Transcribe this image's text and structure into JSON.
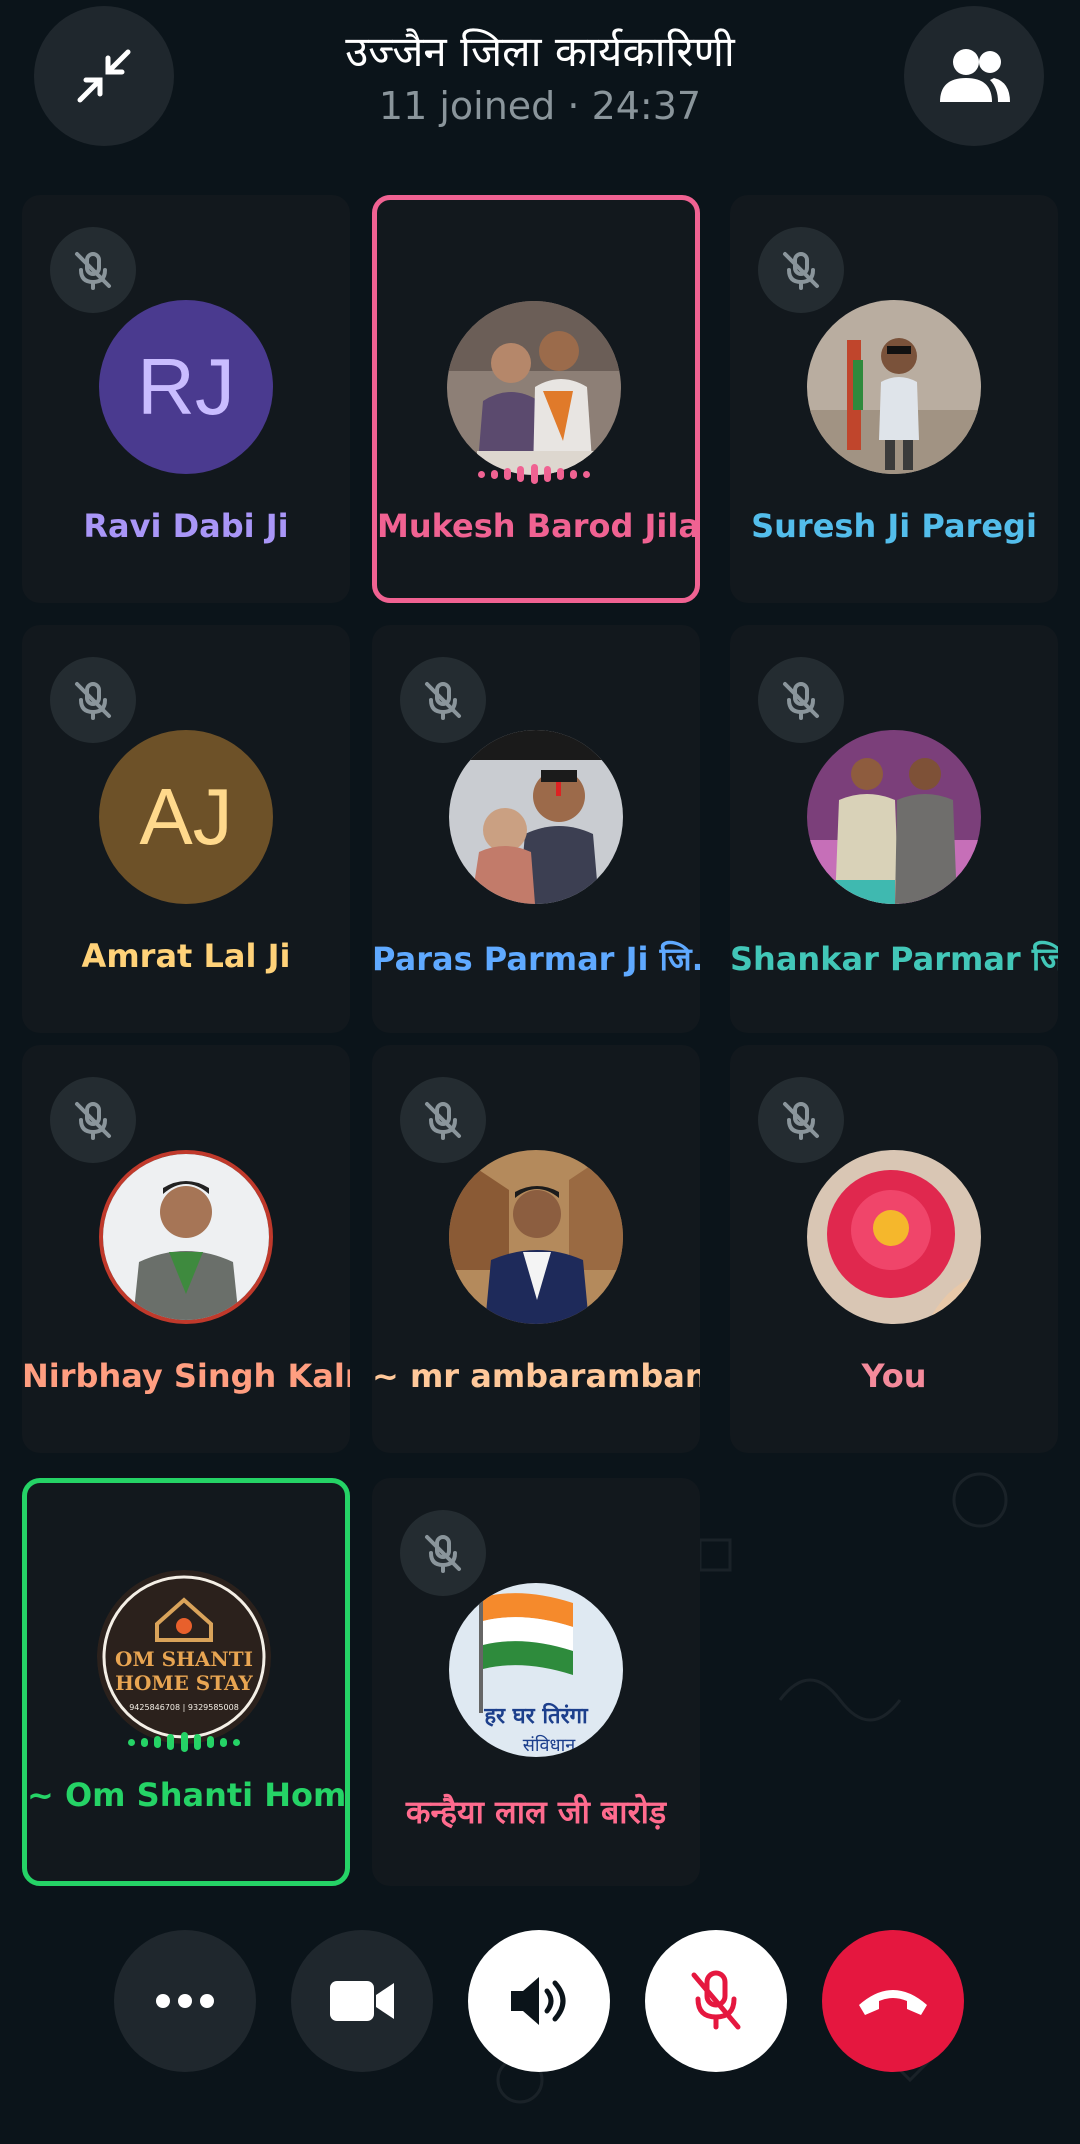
{
  "call": {
    "title": "उज्जैन जिला कार्यकारिणी",
    "joined": "11 joined",
    "separator": "·",
    "duration": "24:37"
  },
  "colors": {
    "background": "#0b141a",
    "tile": "#12181d",
    "speaking_pink": "#f06292",
    "speaking_green": "#25d366",
    "end_call": "#e5173f"
  },
  "participants": [
    {
      "name": "Ravi Dabi Ji",
      "initials": "RJ",
      "muted": true,
      "speaking": false,
      "name_color": "#a996f7"
    },
    {
      "name": "Mukesh Barod Jila ...",
      "muted": false,
      "speaking": true,
      "name_color": "#f06292"
    },
    {
      "name": "Suresh Ji Paregi",
      "muted": true,
      "speaking": false,
      "name_color": "#53bdeb"
    },
    {
      "name": "Amrat Lal Ji",
      "initials": "AJ",
      "muted": true,
      "speaking": false,
      "name_color": "#ffd279"
    },
    {
      "name": "Paras Parmar Ji जि...",
      "muted": true,
      "speaking": false,
      "name_color": "#5fa9ff"
    },
    {
      "name": "Shankar Parmar जि...",
      "muted": true,
      "speaking": false,
      "name_color": "#42c7b8"
    },
    {
      "name": "Nirbhay Singh Kalm...",
      "muted": true,
      "speaking": false,
      "name_color": "#ff9e80"
    },
    {
      "name": "~ mr ambarambani...",
      "muted": true,
      "speaking": false,
      "name_color": "#ffc89a"
    },
    {
      "name": "You",
      "muted": true,
      "speaking": false,
      "name_color": "#f48a9b"
    },
    {
      "name": "~ Om Shanti Home ...",
      "muted": false,
      "speaking": true,
      "name_color": "#25d366"
    },
    {
      "name": "कन्हैया लाल जी बारोड़",
      "muted": true,
      "speaking": false,
      "name_color": "#ff6b8e"
    }
  ],
  "om_logo": {
    "line1": "OM SHANTI",
    "line2": "HOME STAY",
    "phones": "9425846708 | 9329585008"
  },
  "flag_card": {
    "text1": "हर घर तिरंगा",
    "text2": "संविधान"
  },
  "controls": {
    "more": "more-icon",
    "video": "video-camera-icon",
    "speaker": "speaker-icon",
    "mic": "mic-off-icon",
    "end": "end-call-icon"
  }
}
